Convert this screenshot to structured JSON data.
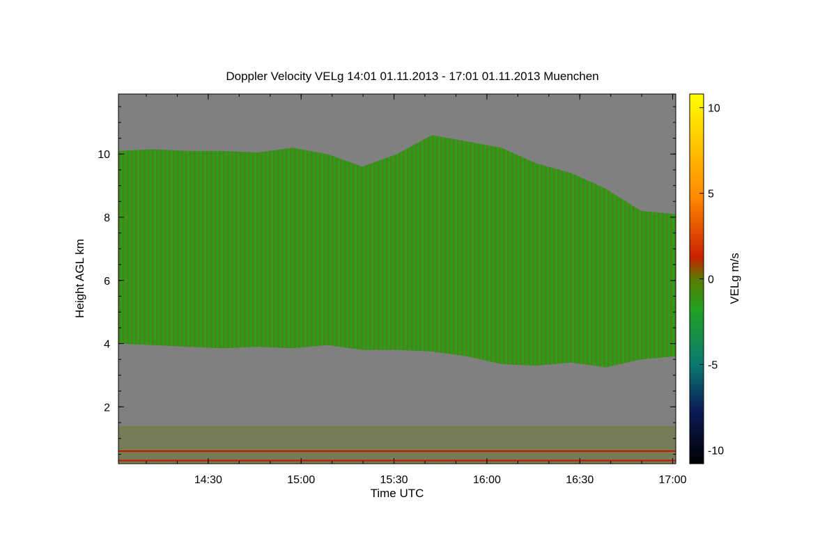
{
  "chart_data": {
    "type": "heatmap",
    "title": "Doppler Velocity VELg   14:01 01.11.2013 - 17:01 01.11.2013 Muenchen",
    "xlabel": "Time UTC",
    "ylabel": "Height AGL km",
    "xlim": [
      "14:01",
      "17:01"
    ],
    "ylim": [
      0.2,
      11.9
    ],
    "x_ticks": [
      "14:30",
      "15:00",
      "15:30",
      "16:00",
      "16:30",
      "17:00"
    ],
    "y_ticks": [
      "2",
      "4",
      "6",
      "8",
      "10"
    ],
    "colorbar": {
      "label": "VELg m/s",
      "range": [
        -10.8,
        10.8
      ],
      "ticks": [
        "10",
        "5",
        "0",
        "-5",
        "-10"
      ],
      "colors": [
        "#000000",
        "#0a1a55",
        "#0a7a70",
        "#22a020",
        "#5a7a00",
        "#cc2200",
        "#ff8800",
        "#ffff00"
      ]
    },
    "no_data_color": "#808080",
    "cloud_layer": {
      "top_km": [
        10.1,
        10.15,
        10.1,
        10.1,
        10.05,
        10.2,
        10.0,
        9.6,
        10.0,
        10.6,
        10.4,
        10.2,
        9.7,
        9.4,
        8.9,
        8.2,
        8.1
      ],
      "base_km": [
        4.0,
        3.95,
        3.9,
        3.85,
        3.9,
        3.85,
        3.95,
        3.8,
        3.8,
        3.75,
        3.6,
        3.35,
        3.3,
        3.4,
        3.25,
        3.5,
        3.6
      ]
    },
    "boundary_layer": {
      "top_km": 1.4,
      "red_lines_km": [
        0.6,
        0.3
      ]
    }
  }
}
